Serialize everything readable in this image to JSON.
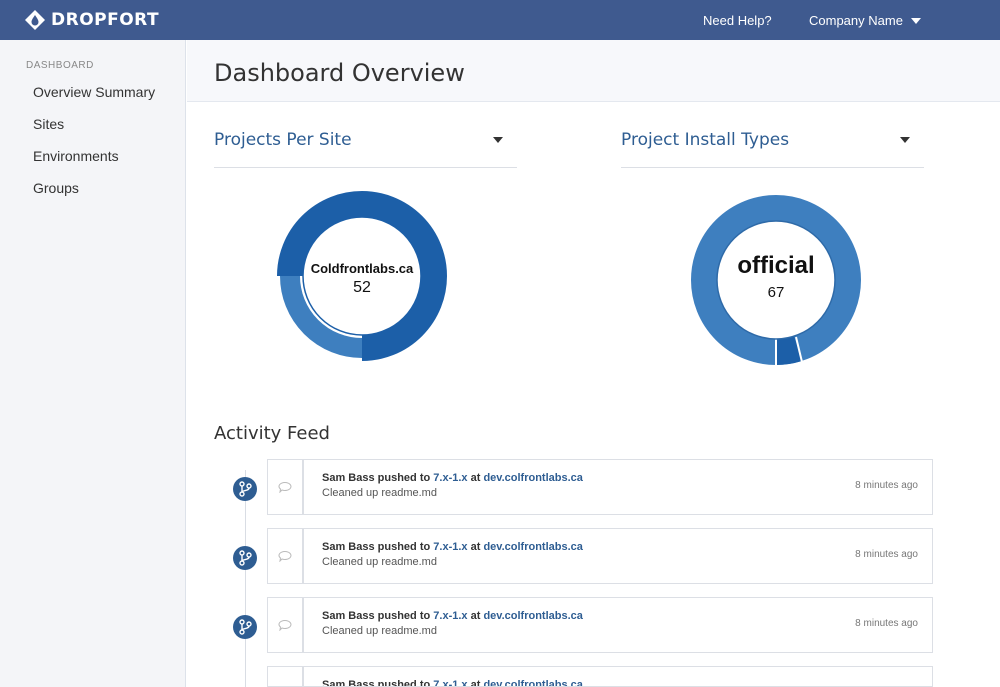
{
  "brand": {
    "name": "DROPFORT",
    "logo_icon": "dropfort-logo-icon"
  },
  "topbar": {
    "help_label": "Need Help?",
    "company_label": "Company Name"
  },
  "sidebar": {
    "heading": "DASHBOARD",
    "items": [
      {
        "label": "Overview Summary"
      },
      {
        "label": "Sites"
      },
      {
        "label": "Environments"
      },
      {
        "label": "Groups"
      }
    ]
  },
  "page": {
    "title": "Dashboard Overview"
  },
  "panels": {
    "projects_per_site": {
      "title": "Projects Per Site",
      "center_label": "Coldfrontlabs.ca",
      "center_value": "52",
      "colors": {
        "highlight": "#1c5fa8",
        "other": "#3e7fbf"
      }
    },
    "install_types": {
      "title": "Project Install Types",
      "center_label": "official",
      "center_value": "67",
      "colors": {
        "highlight": "#1c5fa8",
        "other": "#3e7fbf"
      }
    }
  },
  "activity": {
    "title": "Activity Feed",
    "items": [
      {
        "user": "Sam Bass",
        "action": "pushed to",
        "branch": "7.x-1.x",
        "at": "at",
        "site": "dev.colfrontlabs.ca",
        "message": "Cleaned up readme.md",
        "time": "8 minutes ago"
      },
      {
        "user": "Sam Bass",
        "action": "pushed to",
        "branch": "7.x-1.x",
        "at": "at",
        "site": "dev.colfrontlabs.ca",
        "message": "Cleaned up readme.md",
        "time": "8 minutes ago"
      },
      {
        "user": "Sam Bass",
        "action": "pushed to",
        "branch": "7.x-1.x",
        "at": "at",
        "site": "dev.colfrontlabs.ca",
        "message": "Cleaned up readme.md",
        "time": "8 minutes ago"
      },
      {
        "user": "Sam Bass",
        "action": "pushed to",
        "branch": "7.x-1.x",
        "at": "at",
        "site": "dev.colfrontlabs.ca",
        "message": "",
        "time": ""
      }
    ]
  },
  "accent_color": "#3f5a8f"
}
